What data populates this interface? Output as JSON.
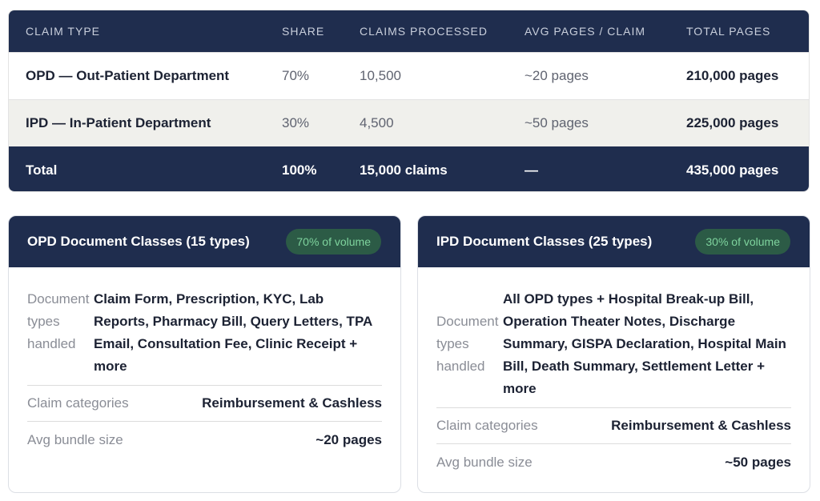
{
  "table": {
    "headers": [
      "CLAIM TYPE",
      "SHARE",
      "CLAIMS PROCESSED",
      "AVG PAGES / CLAIM",
      "TOTAL PAGES"
    ],
    "rows": [
      {
        "type": "OPD — Out-Patient Department",
        "share": "70%",
        "claims": "10,500",
        "avg": "~20 pages",
        "total": "210,000 pages"
      },
      {
        "type": "IPD — In-Patient Department",
        "share": "30%",
        "claims": "4,500",
        "avg": "~50 pages",
        "total": "225,000 pages"
      }
    ],
    "total": {
      "label": "Total",
      "share": "100%",
      "claims": "15,000 claims",
      "avg": "—",
      "total": "435,000 pages"
    }
  },
  "cards": {
    "opd": {
      "title": "OPD Document Classes (15 types)",
      "badge": "70% of volume",
      "types_label": "Document types handled",
      "types_value": "Claim Form, Prescription, KYC, Lab Reports, Pharmacy Bill, Query Letters, TPA Email, Consultation Fee, Clinic Receipt + more",
      "categories_label": "Claim categories",
      "categories_value": "Reimbursement & Cashless",
      "bundle_label": "Avg bundle size",
      "bundle_value": "~20 pages"
    },
    "ipd": {
      "title": "IPD Document Classes (25 types)",
      "badge": "30% of volume",
      "types_label": "Document types handled",
      "types_value": "All OPD types + Hospital Break-up Bill, Operation Theater Notes, Discharge Summary, GISPA Declaration, Hospital Main Bill, Death Summary, Settlement Letter + more",
      "categories_label": "Claim categories",
      "categories_value": "Reimbursement & Cashless",
      "bundle_label": "Avg bundle size",
      "bundle_value": "~50 pages"
    }
  },
  "colors": {
    "navy": "#1f2d4e",
    "badge_bg": "#2c5b46",
    "badge_text": "#7fd49e",
    "alt_row": "#f0f0ec"
  }
}
